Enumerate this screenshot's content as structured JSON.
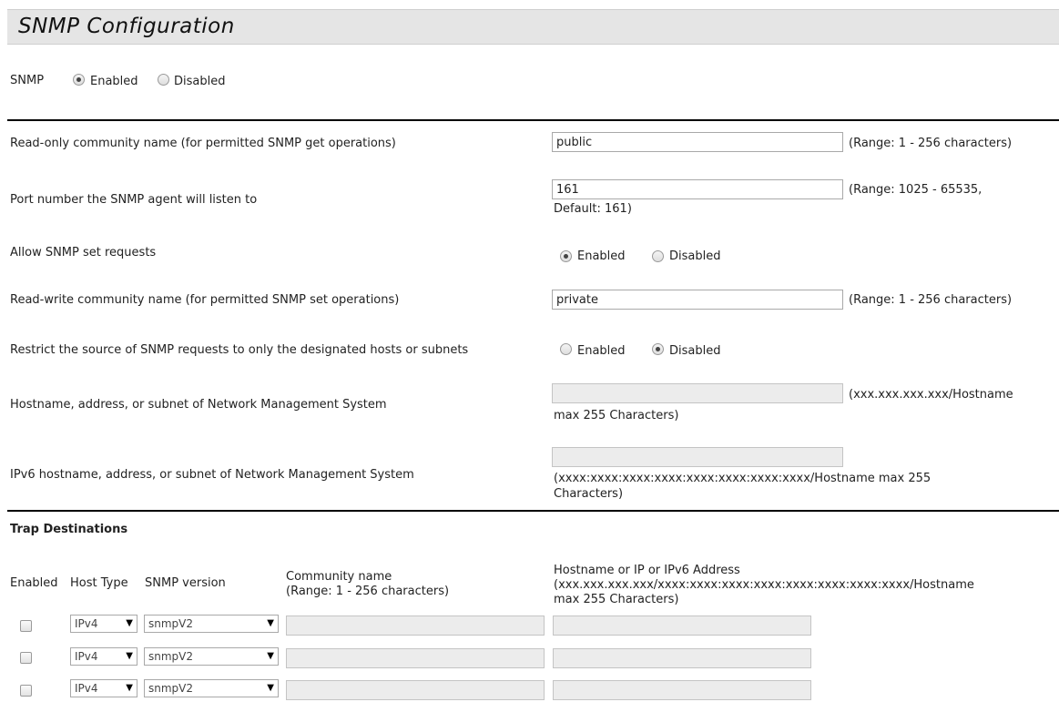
{
  "page": {
    "title": "SNMP Configuration"
  },
  "snmp": {
    "label": "SNMP",
    "enabled": "Enabled",
    "disabled": "Disabled"
  },
  "form": {
    "ro_community": {
      "label": "Read-only community name (for permitted SNMP get operations)",
      "value": "public",
      "hint": "(Range: 1 - 256 characters)"
    },
    "port": {
      "label": "Port number the SNMP agent will listen to",
      "value": "161",
      "hint1": "(Range: 1025 - 65535,",
      "hint2": "Default: 161)"
    },
    "allow_set": {
      "label": "Allow SNMP set requests",
      "enabled": "Enabled",
      "disabled": "Disabled"
    },
    "rw_community": {
      "label": "Read-write community name (for permitted SNMP set operations)",
      "value": "private",
      "hint": "(Range: 1 - 256 characters)"
    },
    "restrict": {
      "label": "Restrict the source of SNMP requests to only the designated hosts or subnets",
      "enabled": "Enabled",
      "disabled": "Disabled"
    },
    "nms": {
      "label": "Hostname, address, or subnet of Network Management System",
      "value": "",
      "hint1": "(xxx.xxx.xxx.xxx/Hostname",
      "hint2": "max 255 Characters)"
    },
    "nms_ipv6": {
      "label": "IPv6 hostname, address, or subnet of Network Management System",
      "value": "",
      "hint1": "(xxxx:xxxx:xxxx:xxxx:xxxx:xxxx:xxxx:xxxx/Hostname max 255",
      "hint2": "Characters)"
    }
  },
  "trap": {
    "heading": "Trap Destinations",
    "columns": {
      "enabled": "Enabled",
      "host_type": "Host Type",
      "snmp_version": "SNMP version",
      "community1": "Community name",
      "community2": "(Range: 1 - 256 characters)",
      "host1": "Hostname or IP or IPv6 Address",
      "host2": "(xxx.xxx.xxx.xxx/xxxx:xxxx:xxxx:xxxx:xxxx:xxxx:xxxx:xxxx/Hostname",
      "host3": "max 255 Characters)"
    },
    "rows": [
      {
        "host_type": "IPv4",
        "version": "snmpV2"
      },
      {
        "host_type": "IPv4",
        "version": "snmpV2"
      },
      {
        "host_type": "IPv4",
        "version": "snmpV2"
      }
    ]
  }
}
